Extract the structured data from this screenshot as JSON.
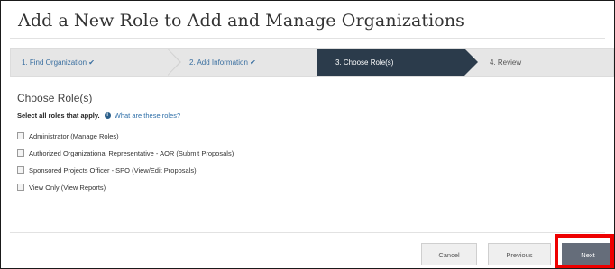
{
  "page_title": "Add a New Role to Add and Manage Organizations",
  "steps": [
    {
      "label": "1. Find Organization ✔"
    },
    {
      "label": "2. Add Information ✔"
    },
    {
      "label": "3. Choose Role(s)"
    },
    {
      "label": "4. Review"
    }
  ],
  "section": {
    "title": "Choose Role(s)",
    "instruction": "Select all roles that apply.",
    "help_icon": "info-icon",
    "help_link": "What are these roles?"
  },
  "roles": [
    {
      "label": "Administrator (Manage Roles)",
      "checked": false
    },
    {
      "label": "Authorized Organizational Representative - AOR (Submit Proposals)",
      "checked": false
    },
    {
      "label": "Sponsored Projects Officer - SPO (View/Edit Proposals)",
      "checked": false
    },
    {
      "label": "View Only (View Reports)",
      "checked": false
    }
  ],
  "buttons": {
    "cancel": "Cancel",
    "previous": "Previous",
    "next": "Next"
  },
  "colors": {
    "active_step": "#2b3b4b",
    "link": "#2f6fa8",
    "next_button": "#656d7a",
    "highlight": "#ee0000"
  }
}
